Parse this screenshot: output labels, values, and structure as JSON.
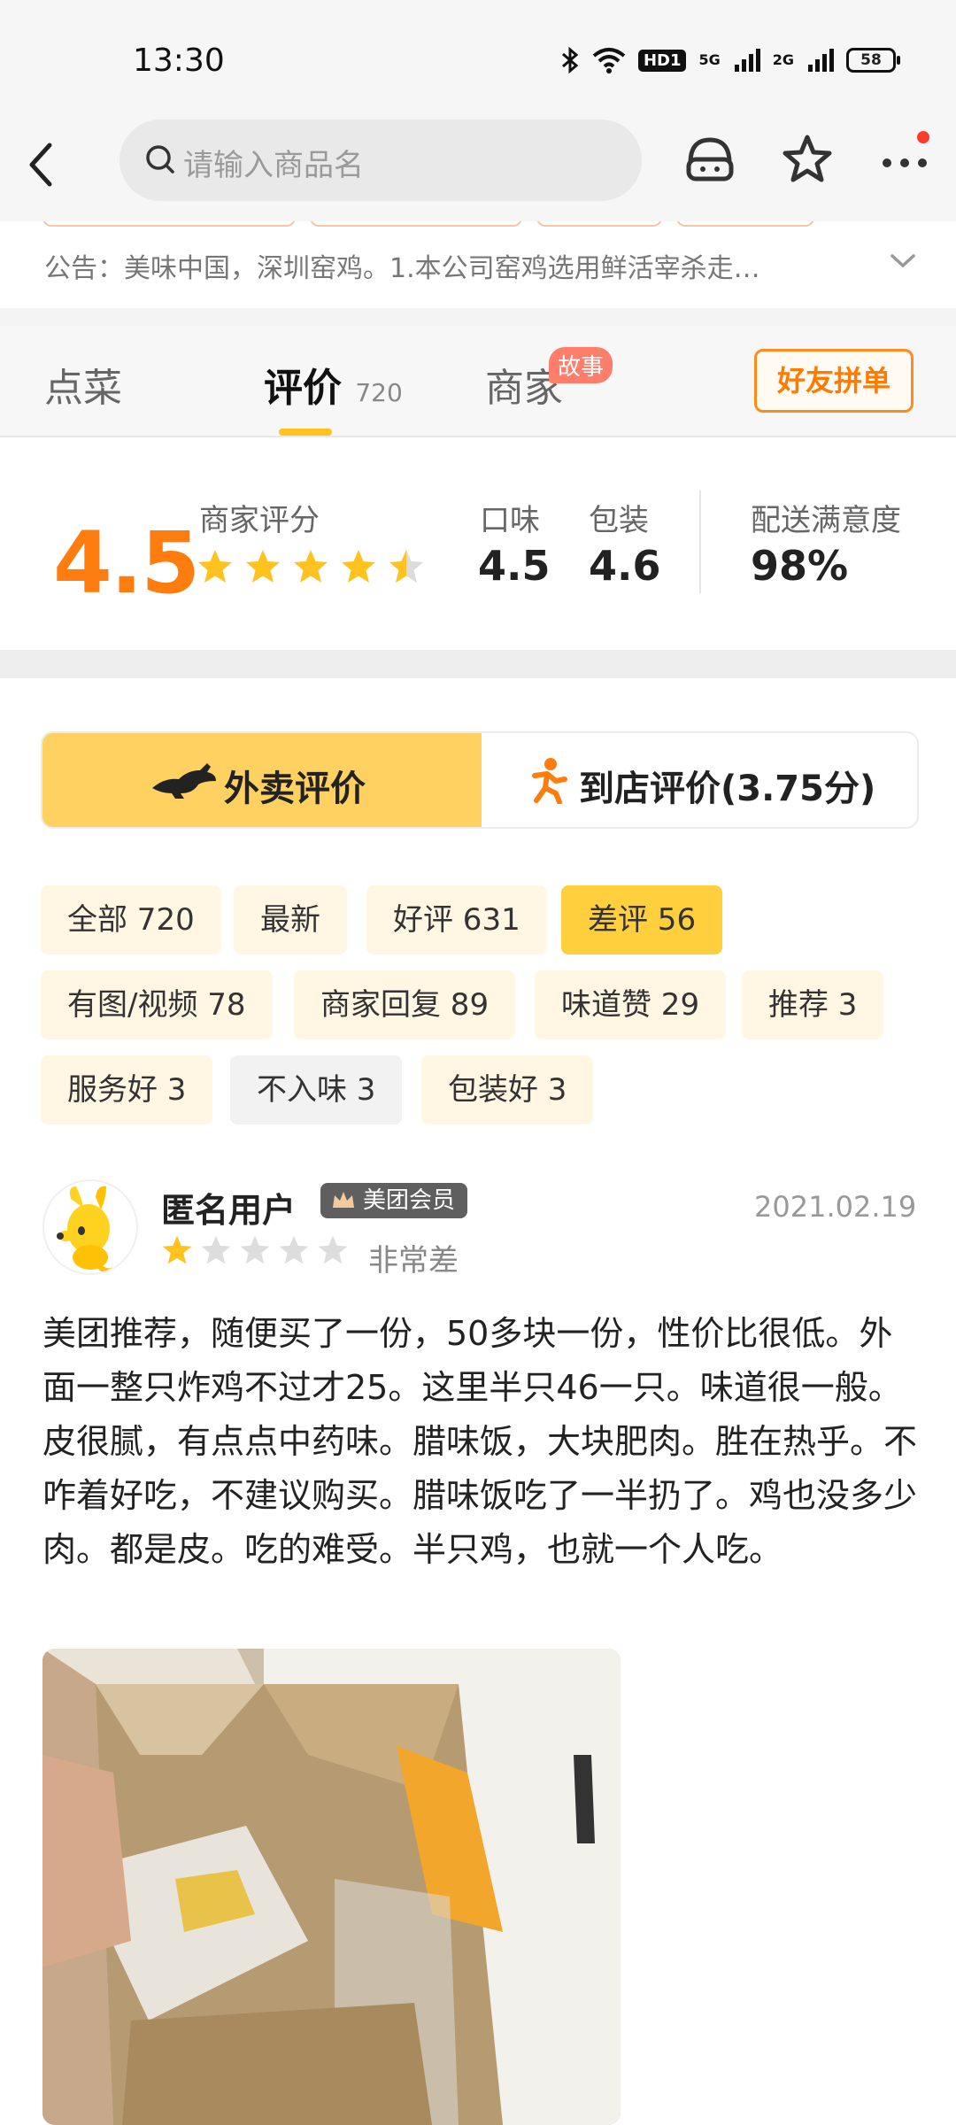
{
  "status": {
    "time": "13:30",
    "network_1": "5G",
    "network_2": "2G",
    "hd": "HD1",
    "battery": "58"
  },
  "search": {
    "placeholder": "请输入商品名"
  },
  "notice": {
    "text": "公告：美味中国，深圳窑鸡。1.本公司窑鸡选用鲜活宰杀走…"
  },
  "tabs": {
    "order": "点菜",
    "review": "评价",
    "review_count": "720",
    "merchant": "商家",
    "story_badge": "故事",
    "friend_button": "好友拼单"
  },
  "rating": {
    "score": "4.5",
    "score_label": "商家评分",
    "score_stars": 4.5,
    "taste_label": "口味",
    "taste_value": "4.5",
    "pack_label": "包装",
    "pack_value": "4.6",
    "delivery_label": "配送满意度",
    "delivery_value": "98%"
  },
  "segment": {
    "delivery": "外卖评价",
    "instore": "到店评价(3.75分)"
  },
  "filters": [
    {
      "label": "全部 720",
      "state": "normal"
    },
    {
      "label": "最新",
      "state": "normal"
    },
    {
      "label": "好评 631",
      "state": "normal"
    },
    {
      "label": "差评 56",
      "state": "active"
    },
    {
      "label": "有图/视频 78",
      "state": "normal"
    },
    {
      "label": "商家回复 89",
      "state": "normal"
    },
    {
      "label": "味道赞 29",
      "state": "normal"
    },
    {
      "label": "推荐 3",
      "state": "normal"
    },
    {
      "label": "服务好 3",
      "state": "normal"
    },
    {
      "label": "不入味 3",
      "state": "gray"
    },
    {
      "label": "包装好 3",
      "state": "normal"
    }
  ],
  "review": {
    "user": "匿名用户",
    "member_badge": "美团会员",
    "date": "2021.02.19",
    "stars": 1,
    "rating_label": "非常差",
    "text": "美团推荐，随便买了一份，50多块一份，性价比很低。外面一整只炸鸡不过才25。这里半只46一只。味道很一般。皮很腻，有点点中药味。腊味饭，大块肥肉。胜在热乎。不咋着好吃，不建议购买。腊味饭吃了一半扔了。鸡也没多少肉。都是皮。吃的难受。半只鸡，也就一个人吃。"
  },
  "colors": {
    "accent": "#ff7d0f",
    "yellow": "#ffd160",
    "chip_active": "#ffcf3e",
    "chip_bg": "#fff6e4"
  }
}
